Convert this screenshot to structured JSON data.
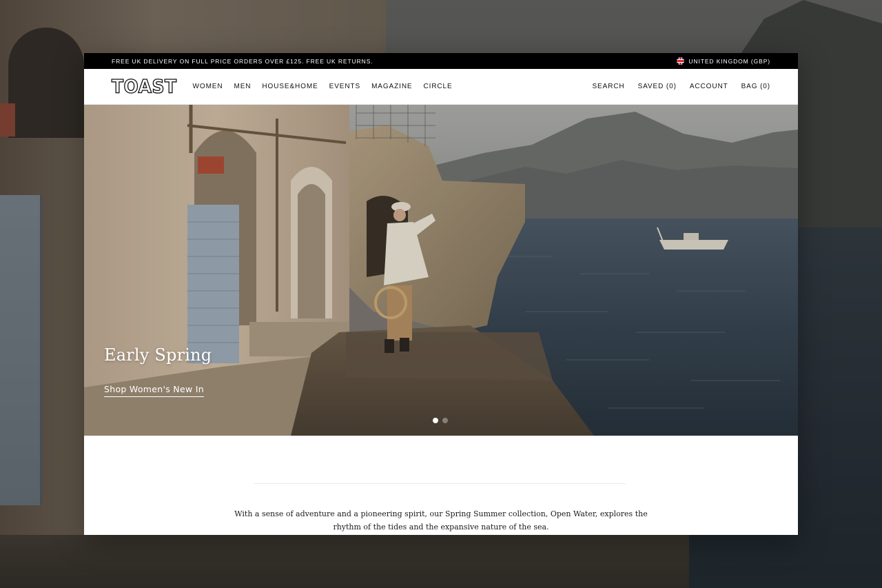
{
  "promo_bar": {
    "message": "FREE UK DELIVERY ON FULL PRICE ORDERS OVER £125. FREE UK RETURNS.",
    "region_icon": "uk-flag-icon",
    "region_label": "UNITED KINGDOM (GBP)"
  },
  "header": {
    "logo": "TOAST",
    "nav": [
      {
        "label": "WOMEN"
      },
      {
        "label": "MEN"
      },
      {
        "label": "HOUSE&HOME"
      },
      {
        "label": "EVENTS"
      },
      {
        "label": "MAGAZINE"
      },
      {
        "label": "CIRCLE"
      }
    ],
    "utility": {
      "search": "SEARCH",
      "saved": "SAVED (0)",
      "account": "ACCOUNT",
      "bag": "BAG (0)"
    }
  },
  "hero": {
    "title": "Early Spring",
    "cta": "Shop Women's New In",
    "slides_total": 2,
    "active_slide": 1
  },
  "intro": {
    "text": "With a sense of adventure and a pioneering spirit, our Spring Summer collection, Open Water, explores the rhythm of the tides and the expansive nature of the sea."
  },
  "colors": {
    "promo_bg": "#000000",
    "page_bg": "#ffffff",
    "text": "#111111"
  }
}
